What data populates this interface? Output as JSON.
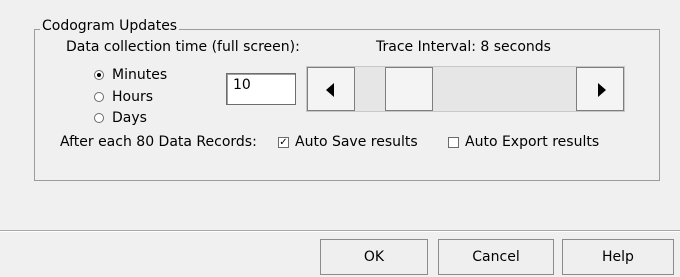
{
  "group": {
    "title": "Codogram Updates"
  },
  "collection": {
    "label": "Data collection time (full screen):",
    "options": [
      {
        "label": "Minutes",
        "selected": true
      },
      {
        "label": "Hours",
        "selected": false
      },
      {
        "label": "Days",
        "selected": false
      }
    ],
    "value": "10"
  },
  "trace": {
    "label": "Trace Interval: 8 seconds",
    "slider_level": 0.28
  },
  "records": {
    "label": "After each 80 Data Records:",
    "auto_save": {
      "label": "Auto Save results",
      "checked": true
    },
    "auto_export": {
      "label": "Auto Export results",
      "checked": false
    }
  },
  "buttons": {
    "ok": "OK",
    "cancel": "Cancel",
    "help": "Help"
  },
  "icons": {
    "scroll_left": "arrow-left-icon",
    "scroll_right": "arrow-right-icon",
    "check_mark": "✓"
  }
}
